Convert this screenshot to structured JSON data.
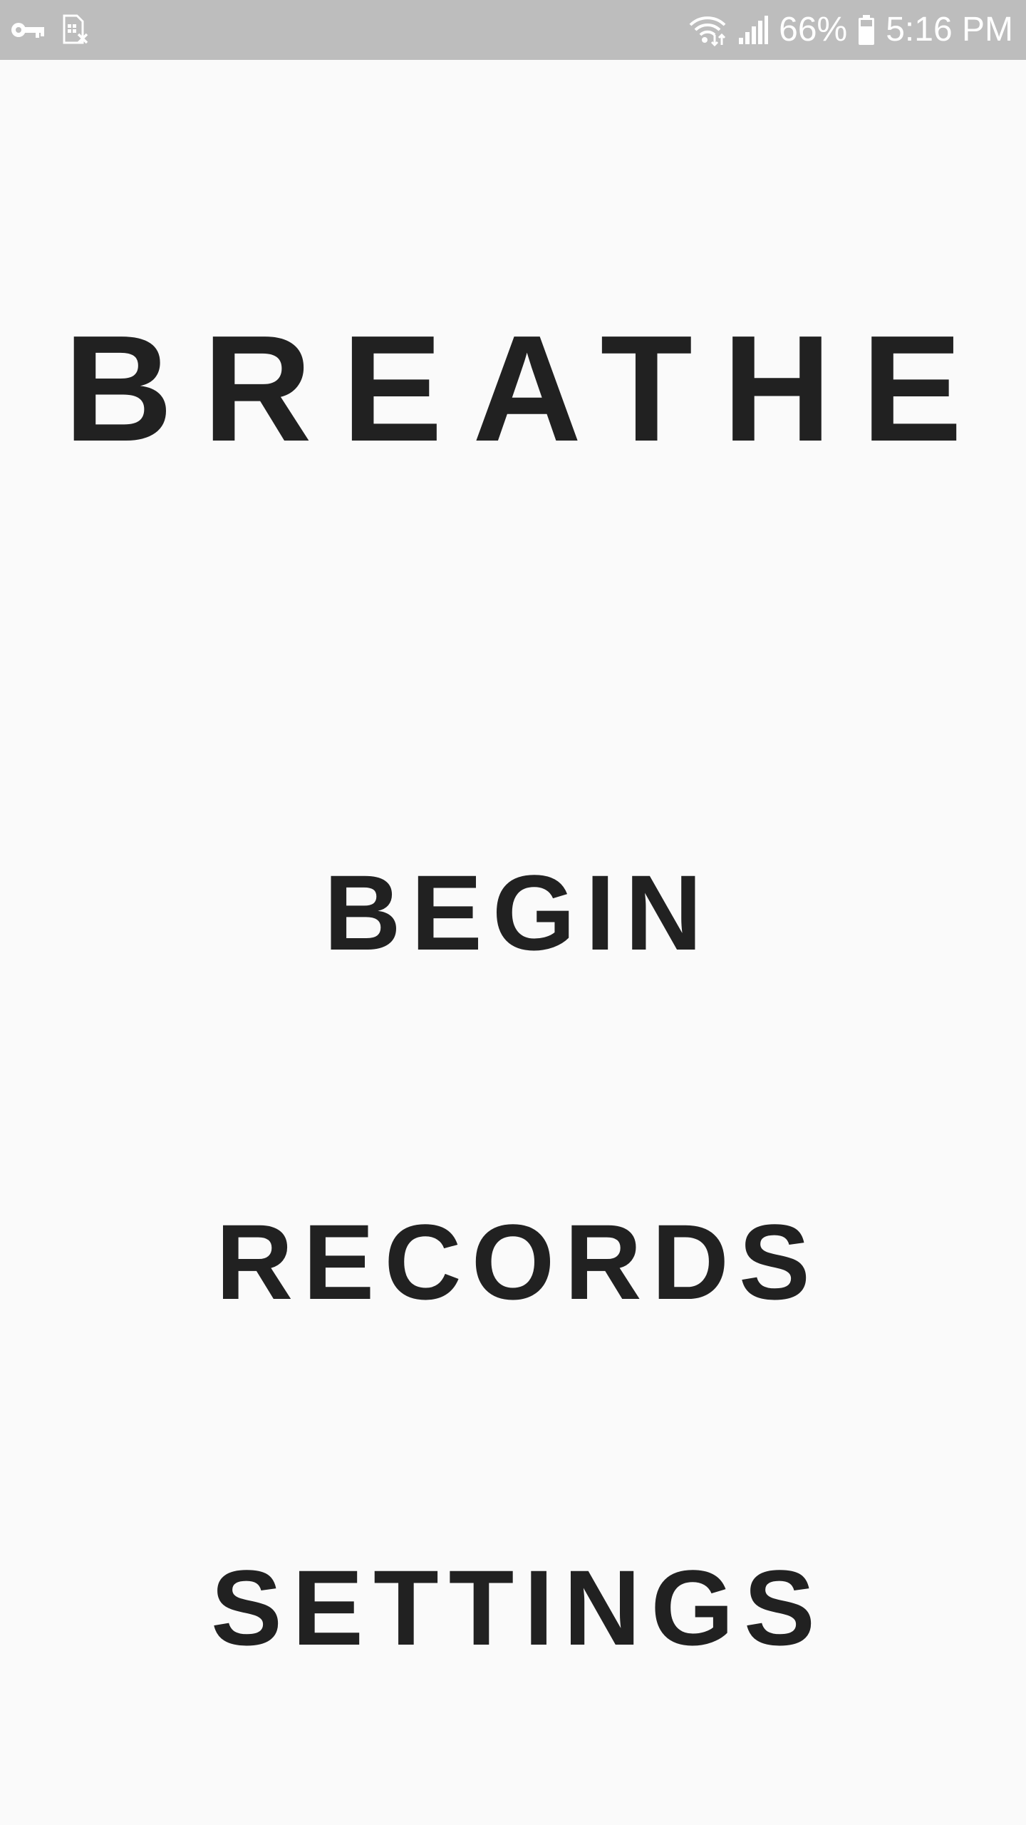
{
  "status_bar": {
    "battery_percent": "66%",
    "time": "5:16 PM",
    "left_icons": [
      "key-icon",
      "sim-card-off-icon"
    ],
    "right_icons": [
      "wifi-icon",
      "signal-icon",
      "battery-icon"
    ],
    "background_color": "#bdbdbd"
  },
  "app": {
    "title": "BREATHE"
  },
  "menu": {
    "begin_label": "BEGIN",
    "records_label": "RECORDS",
    "settings_label": "SETTINGS"
  },
  "colors": {
    "background": "#fafafa",
    "text": "#212121"
  }
}
